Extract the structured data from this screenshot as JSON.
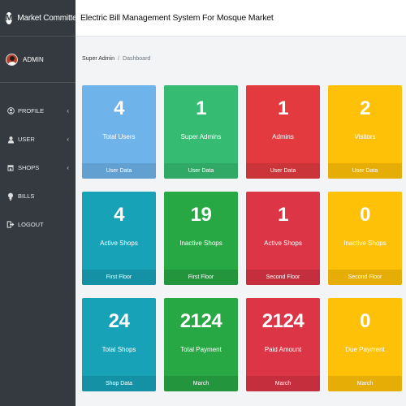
{
  "brand": {
    "logo_letter": "M",
    "name": "Market Committee"
  },
  "user": {
    "name": "ADMIN"
  },
  "nav": [
    {
      "label": "PROFILE",
      "icon": "user-circle-icon",
      "caret": "‹"
    },
    {
      "label": "USER",
      "icon": "user-icon",
      "caret": "‹"
    },
    {
      "label": "SHOPS",
      "icon": "store-icon",
      "caret": "‹"
    },
    {
      "label": "BILLS",
      "icon": "lightbulb-icon",
      "caret": ""
    },
    {
      "label": "LOGOUT",
      "icon": "logout-icon",
      "caret": ""
    }
  ],
  "header": {
    "title": "Electric Bill Management System For Mosque Market"
  },
  "breadcrumb": {
    "home": "Super Admin",
    "separator": "/",
    "current": "Dashboard"
  },
  "cards": [
    {
      "value": "4",
      "label": "Total Users",
      "footer": "User Data",
      "color": "#6eb3ea"
    },
    {
      "value": "1",
      "label": "Super Admins",
      "footer": "User Data",
      "color": "#36bb72"
    },
    {
      "value": "1",
      "label": "Admins",
      "footer": "User Data",
      "color": "#e33a3f"
    },
    {
      "value": "2",
      "label": "Visitors",
      "footer": "User Data",
      "color": "#ffc107"
    },
    {
      "value": "4",
      "label": "Active Shops",
      "footer": "First Floor",
      "color": "#17a2b8"
    },
    {
      "value": "19",
      "label": "Inactive Shops",
      "footer": "First Floor",
      "color": "#28a745"
    },
    {
      "value": "1",
      "label": "Active Shops",
      "footer": "Second Floor",
      "color": "#dc3545"
    },
    {
      "value": "0",
      "label": "Inactive Shops",
      "footer": "Second Floor",
      "color": "#ffc107"
    },
    {
      "value": "24",
      "label": "Total Shops",
      "footer": "Shop Data",
      "color": "#17a2b8"
    },
    {
      "value": "2124",
      "label": "Total Payment",
      "footer": "March",
      "color": "#28a745"
    },
    {
      "value": "2124",
      "label": "Paid Amount",
      "footer": "March",
      "color": "#dc3545"
    },
    {
      "value": "0",
      "label": "Due Payment",
      "footer": "March",
      "color": "#ffc107"
    }
  ]
}
